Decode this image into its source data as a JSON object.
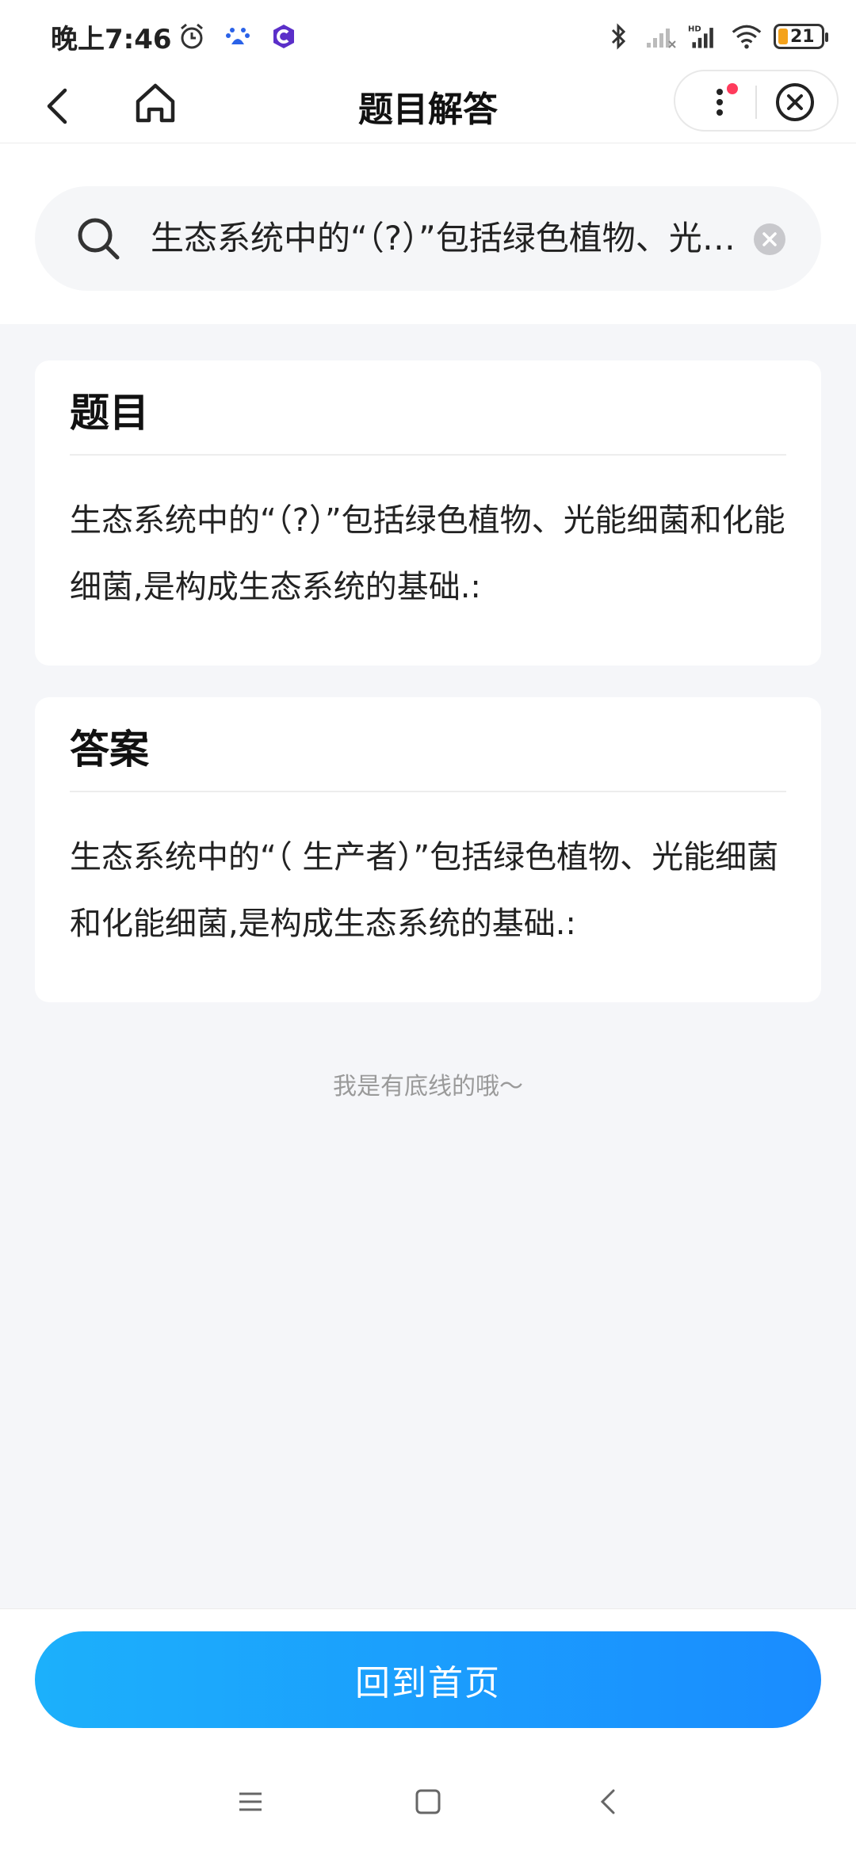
{
  "status_bar": {
    "time": "晚上7:46",
    "battery_level": "21",
    "battery_color": "#f4a21b",
    "left_icons": [
      "alarm-icon",
      "baidu-icon",
      "app-c-icon"
    ],
    "right_icons": [
      "bluetooth-icon",
      "signal-empty-icon",
      "hd-signal-icon",
      "wifi-icon",
      "battery-icon"
    ]
  },
  "nav": {
    "title": "题目解答",
    "icons": [
      "back-icon",
      "home-icon",
      "more-icon",
      "close-circle-icon"
    ],
    "notification_dot_color": "#ff3b5c"
  },
  "search": {
    "value": "生态系统中的“（?）”包括绿色植物、光能细菌和化能细菌,是构成生态系统的基础.:",
    "icons": [
      "search-icon",
      "clear-icon"
    ]
  },
  "question": {
    "heading": "题目",
    "text": "生态系统中的“（?）”包括绿色植物、光能细菌和化能细菌,是构成生态系统的基础.:"
  },
  "answer": {
    "heading": "答案",
    "text": "生态系统中的“（ 生产者）”包括绿色植物、光能细菌和化能细菌,是构成生态系统的基础.:"
  },
  "footer_note": "我是有底线的哦～",
  "bottom_button": {
    "label": "回到首页",
    "gradient_start": "#1cb0fb",
    "gradient_end": "#1a8cff"
  },
  "system_nav": [
    "menu-icon",
    "square-home-icon",
    "triangle-back-icon"
  ]
}
